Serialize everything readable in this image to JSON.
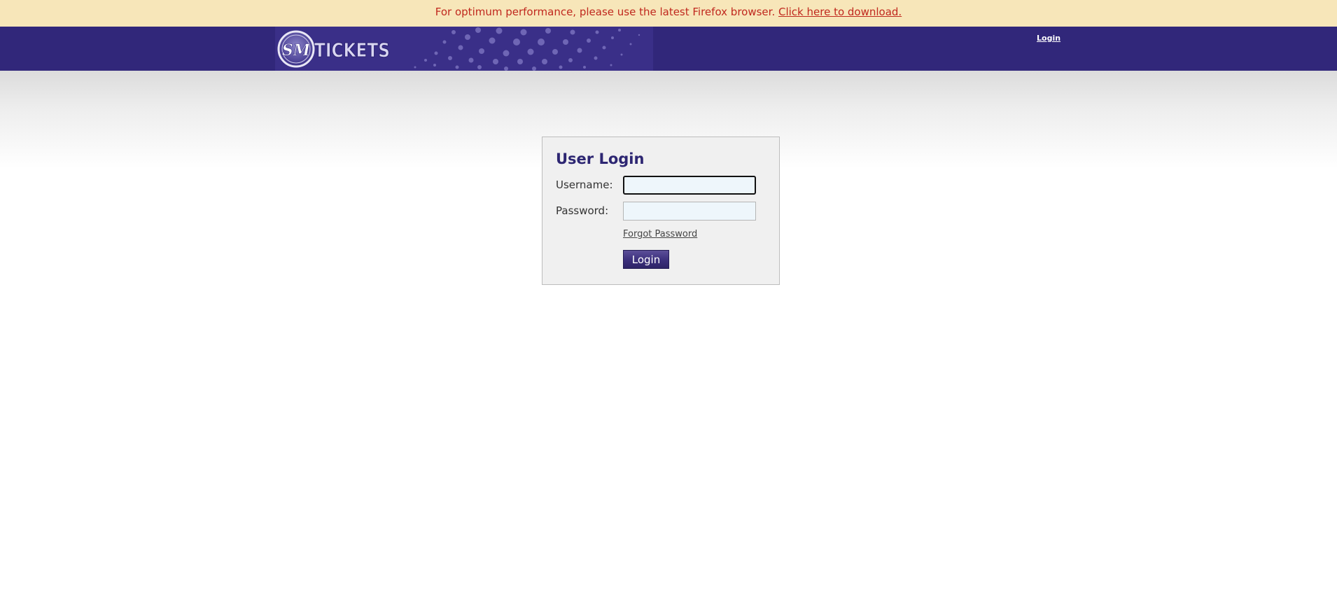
{
  "notice": {
    "message": "For optimum performance, please use the latest Firefox browser. ",
    "download_link": "Click here to download."
  },
  "header": {
    "logo_text": "TICKETS",
    "logo_mark": "SM",
    "login_link": "Login"
  },
  "login_form": {
    "title": "User Login",
    "username_label": "Username:",
    "username_value": "",
    "password_label": "Password:",
    "password_value": "",
    "forgot_password": "Forgot Password",
    "submit_label": "Login"
  },
  "colors": {
    "notice_bg": "#f7e6b9",
    "notice_text": "#c0281e",
    "header_bg": "#31277a",
    "title_color": "#2d2672",
    "button_bg": "#3b2f7c"
  }
}
